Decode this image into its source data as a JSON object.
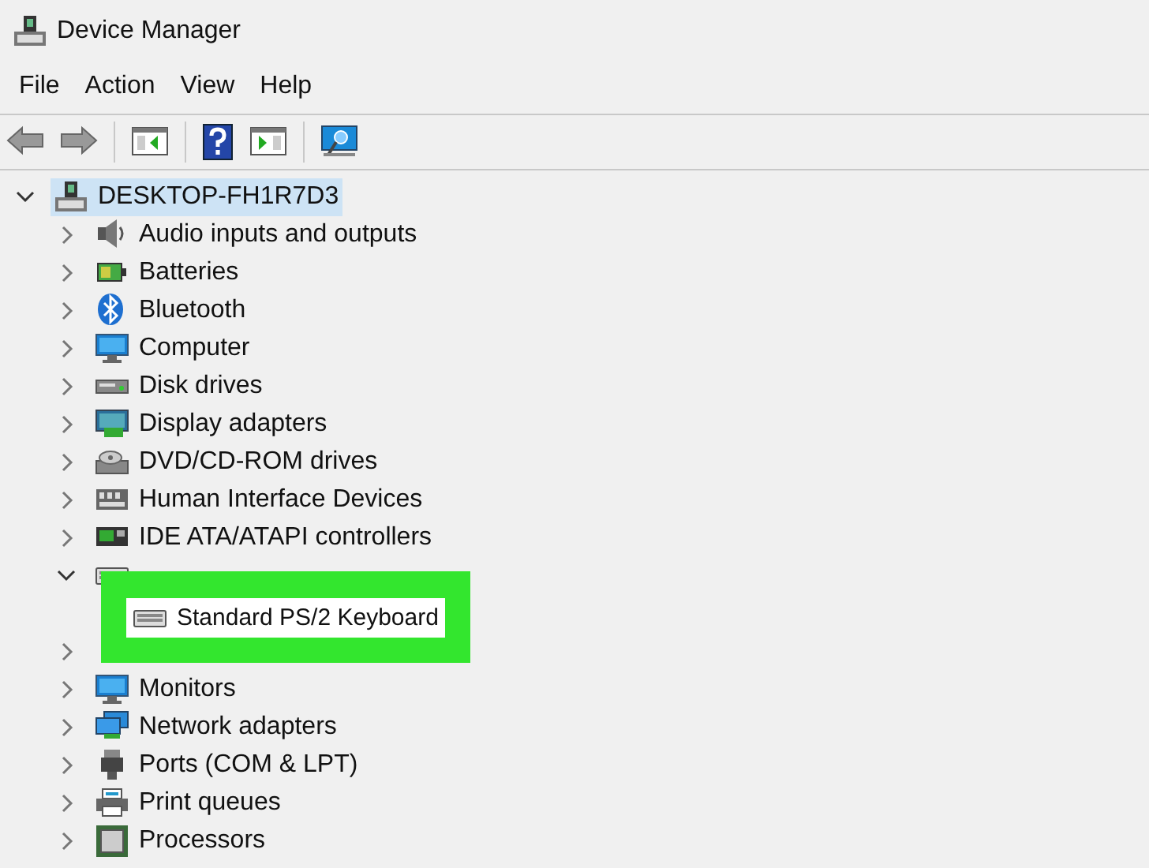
{
  "window": {
    "title": "Device Manager"
  },
  "menu": [
    "File",
    "Action",
    "View",
    "Help"
  ],
  "toolbar": [
    {
      "kind": "back"
    },
    {
      "kind": "forward"
    },
    {
      "kind": "separator"
    },
    {
      "kind": "properties"
    },
    {
      "kind": "separator"
    },
    {
      "kind": "help"
    },
    {
      "kind": "update"
    },
    {
      "kind": "separator"
    },
    {
      "kind": "scan"
    }
  ],
  "tree": {
    "label": "DESKTOP-FH1R7D3",
    "kind": "computer",
    "expanded": true,
    "selected": true,
    "children": [
      {
        "label": "Audio inputs and outputs",
        "kind": "audio",
        "expanded": false,
        "selected": false
      },
      {
        "label": "Batteries",
        "kind": "battery",
        "expanded": false,
        "selected": false
      },
      {
        "label": "Bluetooth",
        "kind": "bluetooth",
        "expanded": false,
        "selected": false
      },
      {
        "label": "Computer",
        "kind": "monitor",
        "expanded": false,
        "selected": false
      },
      {
        "label": "Disk drives",
        "kind": "disk",
        "expanded": false,
        "selected": false
      },
      {
        "label": "Display adapters",
        "kind": "display",
        "expanded": false,
        "selected": false
      },
      {
        "label": "DVD/CD-ROM drives",
        "kind": "dvd",
        "expanded": false,
        "selected": false
      },
      {
        "label": "Human Interface Devices",
        "kind": "hid",
        "expanded": false,
        "selected": false
      },
      {
        "label": "IDE ATA/ATAPI controllers",
        "kind": "ide",
        "expanded": false,
        "selected": false
      },
      {
        "kind": "keyboard",
        "expanded": true,
        "selected": false,
        "children": [
          {
            "label": "Standard PS/2 Keyboard",
            "kind": "keyboard",
            "selected": false,
            "callout": true
          }
        ]
      },
      {
        "expanded": false
      },
      {
        "label": "Monitors",
        "kind": "monitor",
        "expanded": false,
        "selected": false
      },
      {
        "label": "Network adapters",
        "kind": "network",
        "expanded": false,
        "selected": false
      },
      {
        "label": "Ports (COM & LPT)",
        "kind": "port",
        "expanded": false,
        "selected": false
      },
      {
        "label": "Print queues",
        "kind": "printer",
        "expanded": false,
        "selected": false
      },
      {
        "label": "Processors",
        "kind": "processor",
        "expanded": false,
        "selected": false
      }
    ]
  }
}
